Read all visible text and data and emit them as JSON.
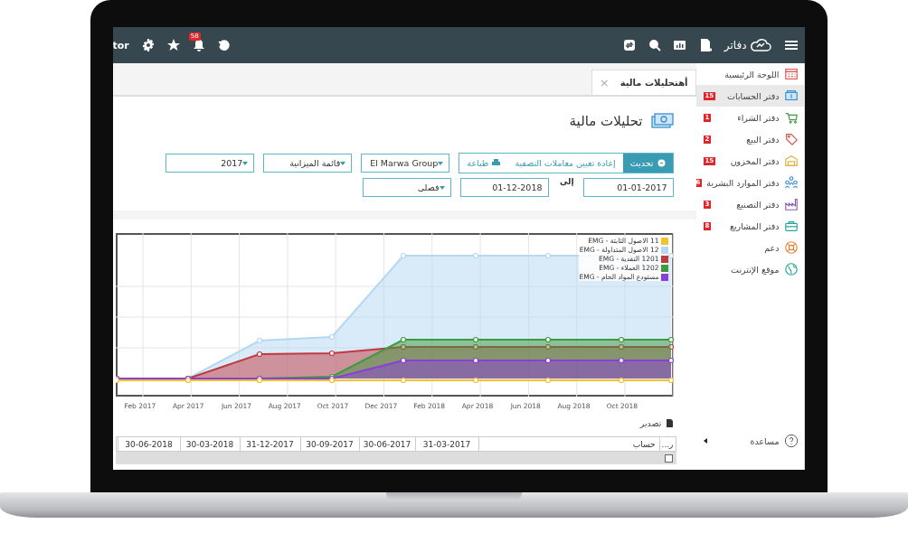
{
  "topbar": {
    "user_fragment": "tor",
    "notifications": "58",
    "logo_text": "دفاتر"
  },
  "tab": {
    "label": "أهتحليلات مالية",
    "close": "×"
  },
  "page_title": "تحليلات مالية",
  "actions": [
    {
      "label": "تحديث",
      "kind": "primary"
    },
    {
      "label": "إعادة تعيين معاملات التصفية",
      "kind": "plain"
    },
    {
      "label": "طباعة",
      "kind": "print"
    }
  ],
  "filters": [
    {
      "value": "El Marwa Group"
    },
    {
      "value": "قائمة الميزانية"
    },
    {
      "value": "2017"
    }
  ],
  "date_from": "01-01-2017",
  "date_to_label": "إلى",
  "date_to": "01-12-2018",
  "period": "فصلى",
  "chart": {
    "legend": [
      {
        "label": "11 الاصول الثابتة - EMG",
        "color": "#f2c12e"
      },
      {
        "label": "12 الاصول المتداولة - EMG",
        "color": "#b4d8f2"
      },
      {
        "label": "1201 النقدية - EMG",
        "color": "#c1393f"
      },
      {
        "label": "1202 العملاء - EMG",
        "color": "#3d9a3d"
      },
      {
        "label": "مستودع المواد الخام - EMG",
        "color": "#8a3fd8"
      }
    ],
    "x_labels": [
      "Oct 2018",
      "Aug 2018",
      "Jun 2018",
      "Apr 2018",
      "Feb 2018",
      "Dec 2017",
      "Oct 2017",
      "Aug 2017",
      "Jun 2017",
      "Apr 2017",
      "Feb 2017"
    ]
  },
  "export_label": "تصدير",
  "table": {
    "columns": [
      "ر...",
      "حساب",
      "31-03-2017",
      "30-06-2017",
      "30-09-2017",
      "31-12-2017",
      "30-03-2018",
      "30-06-2018"
    ],
    "rows": [
      {
        "checked": false
      }
    ]
  },
  "sidebar": {
    "items": [
      {
        "label": "اللوحة الرئيسية",
        "selected": false
      },
      {
        "label": "دفتر الحسابات",
        "badge": "15",
        "selected": true
      },
      {
        "label": "دفتر الشراء",
        "badge": "1",
        "selected": false
      },
      {
        "label": "دفتر البيع",
        "badge": "2",
        "selected": false
      },
      {
        "label": "دفتر المخزون",
        "badge": "15",
        "selected": false
      },
      {
        "label": "دفتر الموارد البشرية",
        "badge": "6",
        "selected": false
      },
      {
        "label": "دفتر التصنيع",
        "badge": "3",
        "selected": false
      },
      {
        "label": "دفتر المشاريع",
        "badge": "8",
        "selected": false
      },
      {
        "label": "دعم",
        "selected": false
      },
      {
        "label": "موقع الإنترنت",
        "selected": false
      }
    ],
    "help": "مساعدة"
  }
}
